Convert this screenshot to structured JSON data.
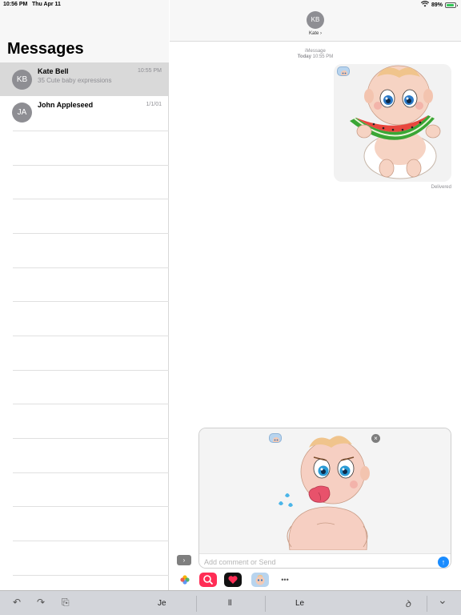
{
  "status_bar": {
    "time": "10:56 PM",
    "date": "Thu Apr 11",
    "battery_text": "89%",
    "battery_level": 0.89
  },
  "sidebar": {
    "title": "Messages",
    "conversations": [
      {
        "initials": "KB",
        "name": "Kate Bell",
        "preview": "35 Cute baby expressions",
        "time": "10:55 PM",
        "selected": true
      },
      {
        "initials": "JA",
        "name": "John Appleseed",
        "preview": "",
        "time": "1/1/01",
        "selected": false
      }
    ]
  },
  "chat": {
    "avatar_initials": "KB",
    "contact_name": "Kate",
    "contact_chevron": "›",
    "service": "iMessage",
    "day_label": "Today",
    "time_label": "10:55 PM",
    "message_status": "Delivered"
  },
  "compose": {
    "placeholder": "Add comment or Send",
    "value": "",
    "close_glyph": "×",
    "send_glyph": "↑",
    "expand_glyph": "›"
  },
  "app_strip": {
    "more_glyph": "•••"
  },
  "keyboard": {
    "undo_glyph": "↶",
    "redo_glyph": "↷",
    "paste_glyph": "⎘",
    "suggestions": [
      "Je",
      "ll",
      "Le"
    ],
    "handwriting_glyph": "ꝺ",
    "dismiss_glyph": "⌄"
  },
  "colors": {
    "accent": "#1a8cff",
    "avatar_gray": "#8e8e93",
    "selected_row": "#d9d9d9",
    "watermelon_red": "#e8473e",
    "watermelon_green": "#3aa635"
  }
}
